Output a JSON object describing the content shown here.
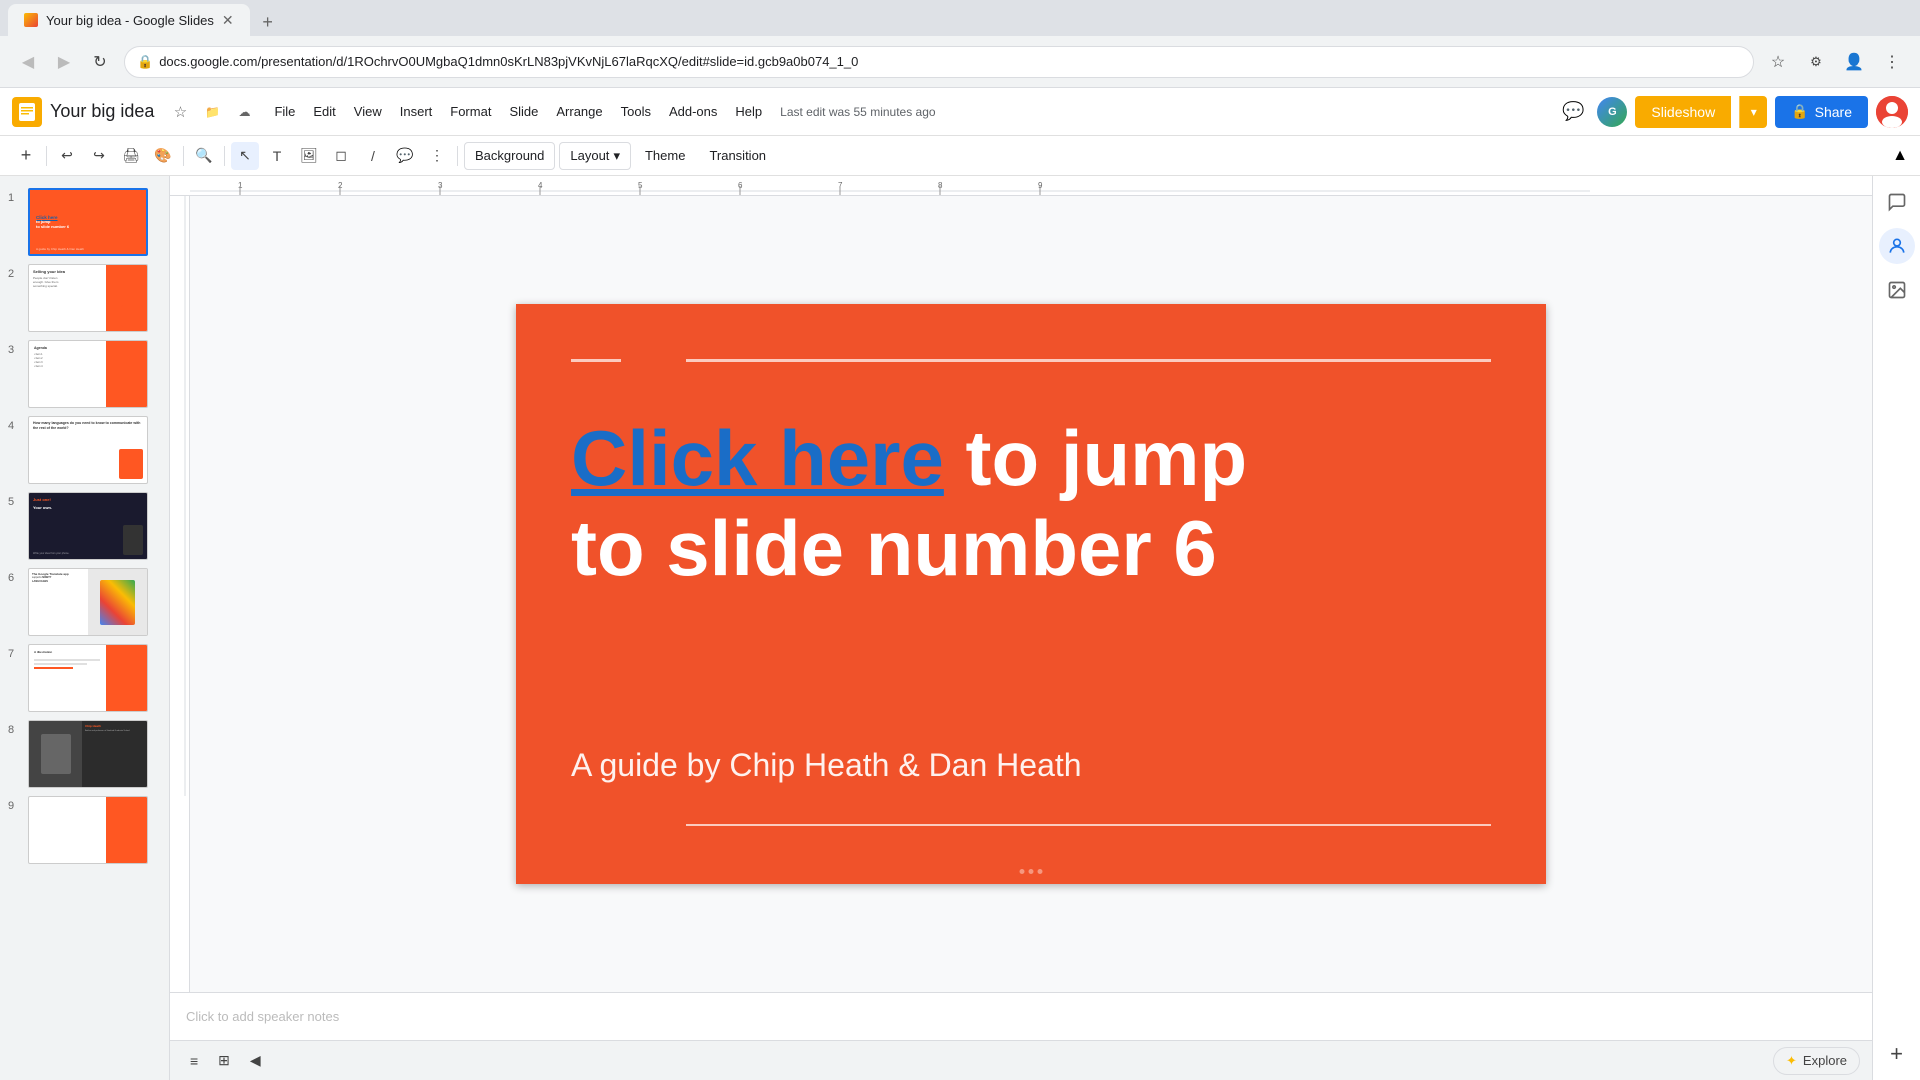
{
  "browser": {
    "tab_title": "Your big idea - Google Slides",
    "url": "docs.google.com/presentation/d/1ROchrvO0UMgbaQ1dmn0sKrLN83pjVKvNjL67laRqcXQ/edit#slide=id.gcb9a0b074_1_0",
    "new_tab_label": "+",
    "back_icon": "◀",
    "forward_icon": "▶",
    "refresh_icon": "↻"
  },
  "app": {
    "logo_letter": "S",
    "title": "Your big idea",
    "star_icon": "☆",
    "folder_icon": "📁",
    "cloud_icon": "☁",
    "last_edit": "Last edit was 55 minutes ago",
    "menu": {
      "file": "File",
      "edit": "Edit",
      "view": "View",
      "insert": "Insert",
      "format": "Format",
      "slide": "Slide",
      "arrange": "Arrange",
      "tools": "Tools",
      "addons": "Add-ons",
      "help": "Help"
    },
    "slideshow_btn": "Slideshow",
    "share_btn": "Share",
    "share_icon": "🔒"
  },
  "toolbar": {
    "add_icon": "+",
    "undo_icon": "↩",
    "redo_icon": "↪",
    "print_icon": "🖨",
    "paint_icon": "🎨",
    "zoom_icon": "🔍",
    "cursor_icon": "↖",
    "text_icon": "T",
    "image_icon": "🖼",
    "shape_icon": "◻",
    "line_icon": "/",
    "more_icon": "⋮",
    "comment_icon": "💬",
    "background_btn": "Background",
    "layout_btn": "Layout",
    "layout_dropdown": "▾",
    "theme_btn": "Theme",
    "transition_btn": "Transition"
  },
  "slide_panel": {
    "slides": [
      {
        "number": "1",
        "type": "orange",
        "text": "Click here to jump to slide number 6"
      },
      {
        "number": "2",
        "type": "white",
        "text": "Selling your Idea"
      },
      {
        "number": "3",
        "type": "white",
        "text": "Agenda"
      },
      {
        "number": "4",
        "type": "white",
        "text": "How many languages do you need to know to communicate with the rest of the world?"
      },
      {
        "number": "5",
        "type": "dark",
        "text": "Just one! Your own."
      },
      {
        "number": "6",
        "type": "white-flags",
        "text": "The Google Translate app supports NINETY LANGUAGES"
      },
      {
        "number": "7",
        "type": "white",
        "text": "A illustration"
      },
      {
        "number": "8",
        "type": "dark-photo",
        "text": "Chip Heath"
      },
      {
        "number": "9",
        "type": "white",
        "text": ""
      }
    ]
  },
  "main_slide": {
    "link_text": "Click here",
    "main_text": " to jump",
    "line2": "to slide number 6",
    "subtitle": "A guide by Chip Heath & Dan Heath"
  },
  "notes": {
    "placeholder": "Click to add speaker notes"
  },
  "bottom": {
    "grid_icon": "⊞",
    "list_icon": "≡",
    "collapse_icon": "◀",
    "explore_label": "Explore",
    "explore_icon": "✦"
  },
  "right_sidebar": {
    "chat_icon": "💬",
    "person_icon": "👤",
    "camera_icon": "📷",
    "add_icon": "+"
  }
}
